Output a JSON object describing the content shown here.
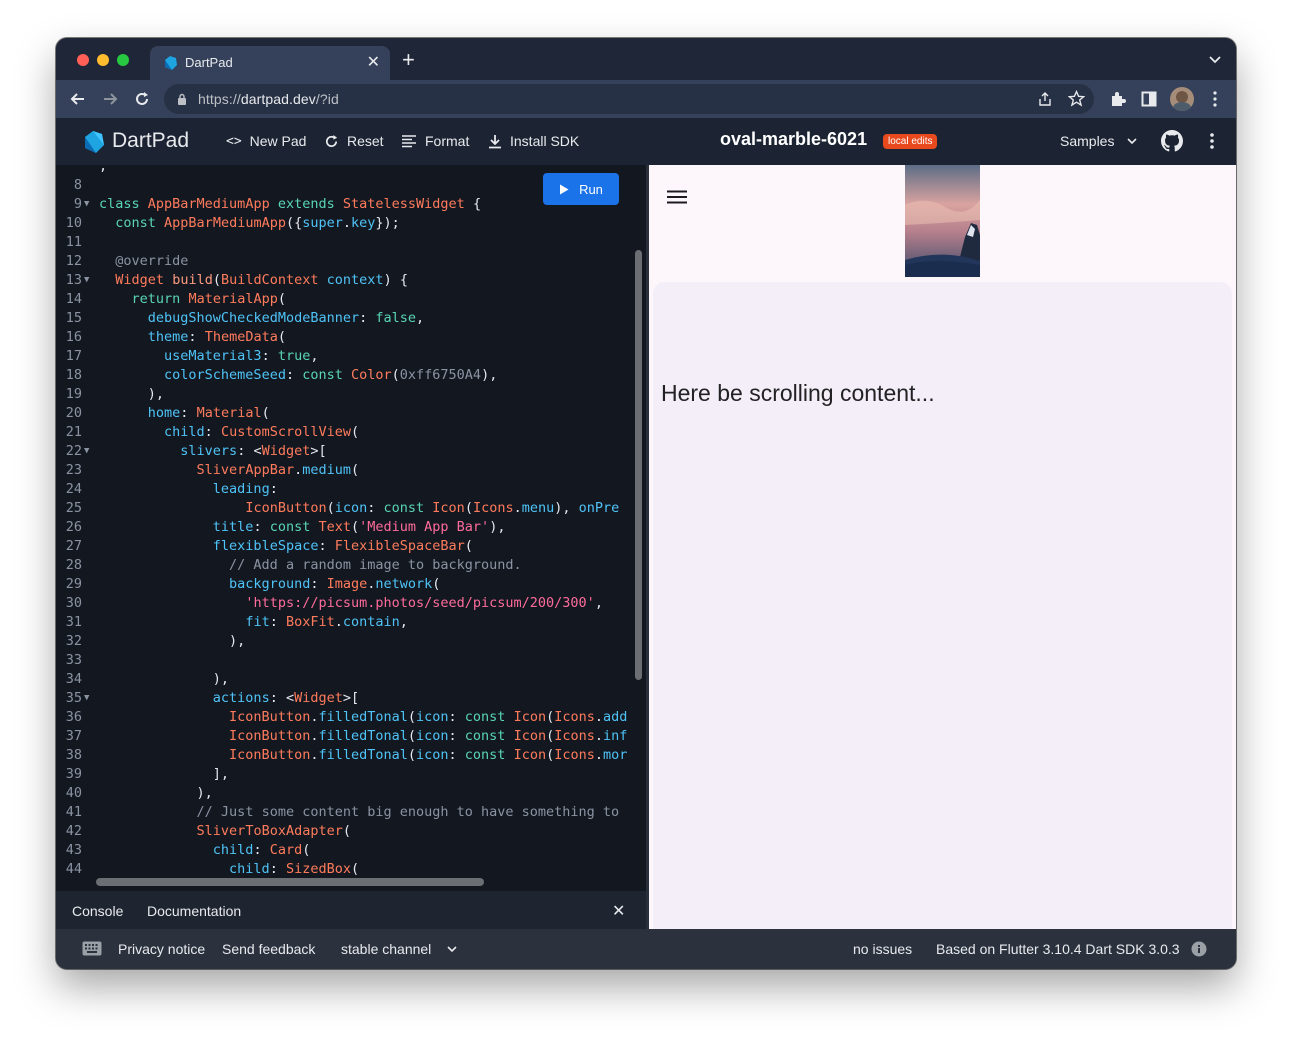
{
  "browser": {
    "tab_title": "DartPad",
    "tab_close": "✕",
    "new_tab": "+",
    "url_scheme": "https://",
    "url_host": "dartpad.dev",
    "url_path": "/?id"
  },
  "header": {
    "logo_text": "DartPad",
    "new_pad": "New Pad",
    "reset": "Reset",
    "format": "Format",
    "install_sdk": "Install SDK",
    "pad_name": "oval-marble-6021",
    "badge": "local edits",
    "samples": "Samples"
  },
  "editor": {
    "run_label": "Run",
    "lines": [
      {
        "n": "8",
        "fold": false,
        "html": ""
      },
      {
        "n": "9",
        "fold": true,
        "html": "<span class=\"k\">class</span> <span class=\"t\">AppBarMediumApp</span> <span class=\"k\">extends</span> <span class=\"t\">StatelessWidget</span> {"
      },
      {
        "n": "10",
        "fold": false,
        "html": "  <span class=\"k\">const</span> <span class=\"t\">AppBarMediumApp</span>({<span class=\"p\">super</span>.<span class=\"p\">key</span>});"
      },
      {
        "n": "11",
        "fold": false,
        "html": ""
      },
      {
        "n": "12",
        "fold": false,
        "html": "  <span class=\"c\">@override</span>"
      },
      {
        "n": "13",
        "fold": true,
        "html": "  <span class=\"t\">Widget</span> <span class=\"f\">build</span>(<span class=\"t\">BuildContext</span> <span class=\"p\">context</span>) {"
      },
      {
        "n": "14",
        "fold": false,
        "html": "    <span class=\"k\">return</span> <span class=\"t\">MaterialApp</span>("
      },
      {
        "n": "15",
        "fold": false,
        "html": "      <span class=\"p\">debugShowCheckedModeBanner</span>: <span class=\"k\">false</span>,"
      },
      {
        "n": "16",
        "fold": false,
        "html": "      <span class=\"p\">theme</span>: <span class=\"t\">ThemeData</span>("
      },
      {
        "n": "17",
        "fold": false,
        "html": "        <span class=\"p\">useMaterial3</span>: <span class=\"k\">true</span>,"
      },
      {
        "n": "18",
        "fold": false,
        "html": "        <span class=\"p\">colorSchemeSeed</span>: <span class=\"k\">const</span> <span class=\"t\">Color</span>(<span class=\"c\">0xff6750A4</span>),"
      },
      {
        "n": "19",
        "fold": false,
        "html": "      ),"
      },
      {
        "n": "20",
        "fold": false,
        "html": "      <span class=\"p\">home</span>: <span class=\"t\">Material</span>("
      },
      {
        "n": "21",
        "fold": false,
        "html": "        <span class=\"p\">child</span>: <span class=\"t\">CustomScrollView</span>("
      },
      {
        "n": "22",
        "fold": true,
        "html": "          <span class=\"p\">slivers</span>: &lt;<span class=\"t\">Widget</span>&gt;["
      },
      {
        "n": "23",
        "fold": false,
        "html": "            <span class=\"t\">SliverAppBar</span>.<span class=\"p\">medium</span>("
      },
      {
        "n": "24",
        "fold": false,
        "html": "              <span class=\"p\">leading</span>:"
      },
      {
        "n": "25",
        "fold": false,
        "html": "                  <span class=\"t\">IconButton</span>(<span class=\"p\">icon</span>: <span class=\"k\">const</span> <span class=\"t\">Icon</span>(<span class=\"t\">Icons</span>.<span class=\"p\">menu</span>), <span class=\"p\">onPre</span>"
      },
      {
        "n": "26",
        "fold": false,
        "html": "              <span class=\"p\">title</span>: <span class=\"k\">const</span> <span class=\"t\">Text</span>(<span class=\"s\">'Medium App Bar'</span>),"
      },
      {
        "n": "27",
        "fold": false,
        "html": "              <span class=\"p\">flexibleSpace</span>: <span class=\"t\">FlexibleSpaceBar</span>("
      },
      {
        "n": "28",
        "fold": false,
        "html": "                <span class=\"c\">// Add a random image to background.</span>"
      },
      {
        "n": "29",
        "fold": false,
        "html": "                <span class=\"p\">background</span>: <span class=\"t\">Image</span>.<span class=\"p\">network</span>("
      },
      {
        "n": "30",
        "fold": false,
        "html": "                  <span class=\"s\">'https://picsum.photos/seed/picsum/200/300'</span>,"
      },
      {
        "n": "31",
        "fold": false,
        "html": "                  <span class=\"p\">fit</span>: <span class=\"t\">BoxFit</span>.<span class=\"p\">contain</span>,"
      },
      {
        "n": "32",
        "fold": false,
        "html": "                ),"
      },
      {
        "n": "33",
        "fold": false,
        "html": ""
      },
      {
        "n": "34",
        "fold": false,
        "html": "              ),"
      },
      {
        "n": "35",
        "fold": true,
        "html": "              <span class=\"p\">actions</span>: &lt;<span class=\"t\">Widget</span>&gt;["
      },
      {
        "n": "36",
        "fold": false,
        "html": "                <span class=\"t\">IconButton</span>.<span class=\"p\">filledTonal</span>(<span class=\"p\">icon</span>: <span class=\"k\">const</span> <span class=\"t\">Icon</span>(<span class=\"t\">Icons</span>.<span class=\"p\">add</span>"
      },
      {
        "n": "37",
        "fold": false,
        "html": "                <span class=\"t\">IconButton</span>.<span class=\"p\">filledTonal</span>(<span class=\"p\">icon</span>: <span class=\"k\">const</span> <span class=\"t\">Icon</span>(<span class=\"t\">Icons</span>.<span class=\"p\">inf</span>"
      },
      {
        "n": "38",
        "fold": false,
        "html": "                <span class=\"t\">IconButton</span>.<span class=\"p\">filledTonal</span>(<span class=\"p\">icon</span>: <span class=\"k\">const</span> <span class=\"t\">Icon</span>(<span class=\"t\">Icons</span>.<span class=\"p\">mor</span>"
      },
      {
        "n": "39",
        "fold": false,
        "html": "              ],"
      },
      {
        "n": "40",
        "fold": false,
        "html": "            ),"
      },
      {
        "n": "41",
        "fold": false,
        "html": "            <span class=\"c\">// Just some content big enough to have something to</span>"
      },
      {
        "n": "42",
        "fold": false,
        "html": "            <span class=\"t\">SliverToBoxAdapter</span>("
      },
      {
        "n": "43",
        "fold": false,
        "html": "              <span class=\"p\">child</span>: <span class=\"t\">Card</span>("
      },
      {
        "n": "44",
        "fold": false,
        "html": "                <span class=\"p\">child</span>: <span class=\"t\">SizedBox</span>("
      }
    ]
  },
  "console": {
    "console_tab": "Console",
    "documentation_tab": "Documentation",
    "close": "✕"
  },
  "preview": {
    "scroll_text": "Here be scrolling content..."
  },
  "footer": {
    "privacy": "Privacy notice",
    "feedback": "Send feedback",
    "channel": "stable channel",
    "issues": "no issues",
    "version": "Based on Flutter 3.10.4 Dart SDK 3.0.3"
  },
  "colors": {
    "accent": "#1a73e8",
    "badge": "#e8491d"
  }
}
